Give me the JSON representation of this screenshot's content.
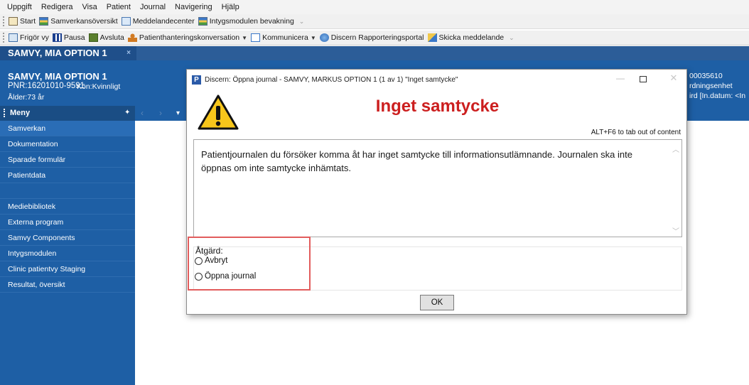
{
  "menubar": {
    "items": [
      "Uppgift",
      "Redigera",
      "Visa",
      "Patient",
      "Journal",
      "Navigering",
      "Hjälp"
    ]
  },
  "toolbar1": {
    "start": "Start",
    "samverkan": "Samverkansöversikt",
    "meddelande": "Meddelandecenter",
    "intyg": "Intygsmodulen bevakning"
  },
  "toolbar2": {
    "frigor": "Frigör vy",
    "pausa": "Pausa",
    "avsluta": "Avsluta",
    "konversation": "Patienthanteringskonversation",
    "kommunicera": "Kommunicera",
    "rapport": "Discern Rapporteringsportal",
    "skicka": "Skicka meddelande"
  },
  "patient_tab": {
    "label": "SAMVY, MIA OPTION 1",
    "close": "×"
  },
  "banner": {
    "name": "SAMVY, MIA OPTION 1",
    "pnr": "PNR:16201010-9591",
    "kon": "Kön:Kvinnligt",
    "alder": "Ålder:73 år",
    "right_line1": "00035610",
    "right_line2": "rdningsenhet",
    "right_line3": "ird [In.datum: <In"
  },
  "sidebar": {
    "header": "Meny",
    "items": [
      "Samverkan",
      "Dokumentation",
      "Sparade formulär",
      "Patientdata",
      "",
      "Mediebibliotek",
      "Externa program",
      "Samvy Components",
      "Intygsmodulen",
      "Clinic patientvy Staging",
      "Resultat, översikt"
    ]
  },
  "nav": {
    "back": "‹",
    "forward": "›",
    "down": "▾"
  },
  "dialog": {
    "app_icon": "P",
    "title": "Discern: Öppna journal - SAMVY, MARKUS OPTION 1 (1 av 1) \"Inget samtycke\"",
    "heading": "Inget samtycke",
    "alt_hint": "ALT+F6 to tab out of content",
    "message": "Patientjournalen du försöker komma åt har inget samtycke till informationsutlämnande. Journalen ska inte öppnas om inte samtycke inhämtats.",
    "action_label": "Åtgärd:",
    "options": [
      "Avbryt",
      "Öppna journal"
    ],
    "ok": "OK"
  },
  "colors": {
    "banner": "#1e5fa5",
    "heading": "#cc1f1f",
    "highlight": "#e25c5c"
  }
}
